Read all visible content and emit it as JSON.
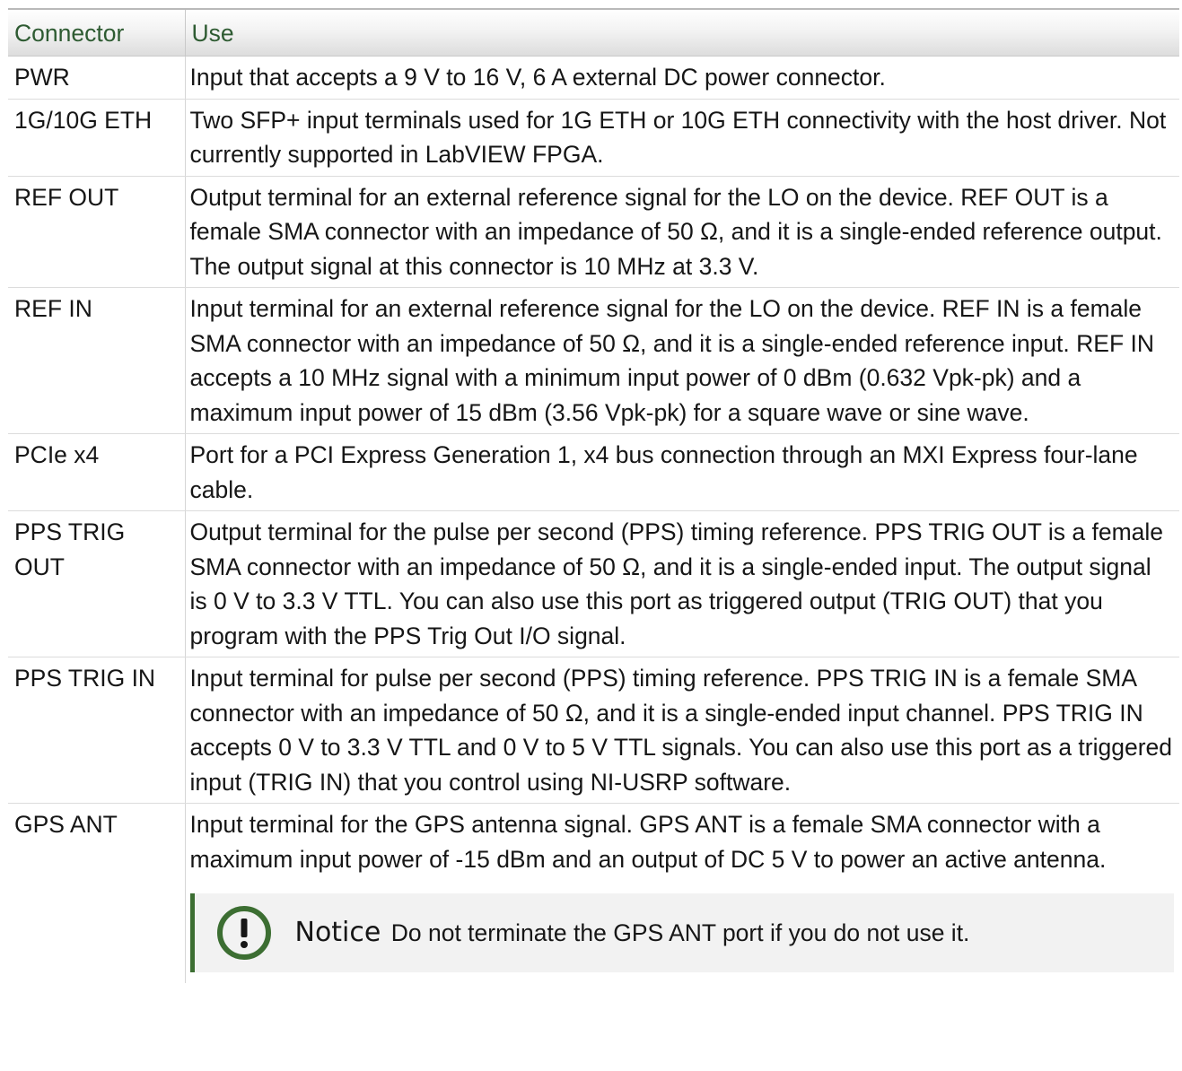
{
  "table": {
    "headers": [
      "Connector",
      "Use"
    ],
    "rows": [
      {
        "connector": "PWR",
        "use": "Input that accepts a 9 V to 16 V, 6 A external DC power connector."
      },
      {
        "connector": "1G/10G ETH",
        "use": "Two SFP+ input terminals used for 1G ETH or 10G ETH connectivity with the host driver. Not currently supported in LabVIEW FPGA."
      },
      {
        "connector": "REF OUT",
        "use": "Output terminal for an external reference signal for the LO on the device. REF OUT is a female SMA connector with an impedance of 50 Ω, and it is a single-ended reference output. The output signal at this connector is 10 MHz at 3.3 V."
      },
      {
        "connector": "REF IN",
        "use": "Input terminal for an external reference signal for the LO on the device. REF IN is a female SMA connector with an impedance of 50 Ω, and it is a single-ended reference input. REF IN accepts a 10 MHz signal with a minimum input power of 0 dBm (0.632 Vpk-pk) and a maximum input power of 15 dBm (3.56 Vpk-pk) for a square wave or sine wave."
      },
      {
        "connector": "PCIe x4",
        "use": "Port for a PCI Express Generation 1, x4 bus connection through an MXI Express four-lane cable."
      },
      {
        "connector": "PPS TRIG OUT",
        "use": "Output terminal for the pulse per second (PPS) timing reference. PPS TRIG OUT is a female SMA connector with an impedance of 50 Ω, and it is a single-ended input. The output signal is 0 V to 3.3 V TTL. You can also use this port as triggered output (TRIG OUT) that you program with the PPS Trig Out I/O signal."
      },
      {
        "connector": "PPS TRIG IN",
        "use": "Input terminal for pulse per second (PPS) timing reference. PPS TRIG IN is a female SMA connector with an impedance of 50 Ω, and it is a single-ended input channel. PPS TRIG IN accepts 0 V to 3.3 V TTL and 0 V to 5 V TTL signals. You can also use this port as a triggered input (TRIG IN) that you control using NI-USRP software."
      },
      {
        "connector": "GPS ANT",
        "use": "Input terminal for the GPS antenna signal. GPS ANT is a female SMA connector with a maximum input power of -15 dBm and an output of DC 5 V to power an active antenna."
      }
    ]
  },
  "notice": {
    "icon": "exclamation-circle-icon",
    "title": "Notice",
    "text": "Do not terminate the GPS ANT port if you do not use it.",
    "accent_color": "#3c6e32",
    "background_color": "#f2f2f2"
  },
  "colors": {
    "header_text": "#2e5b32",
    "body_text": "#161616",
    "grid_lines": "#dcdcdc"
  }
}
